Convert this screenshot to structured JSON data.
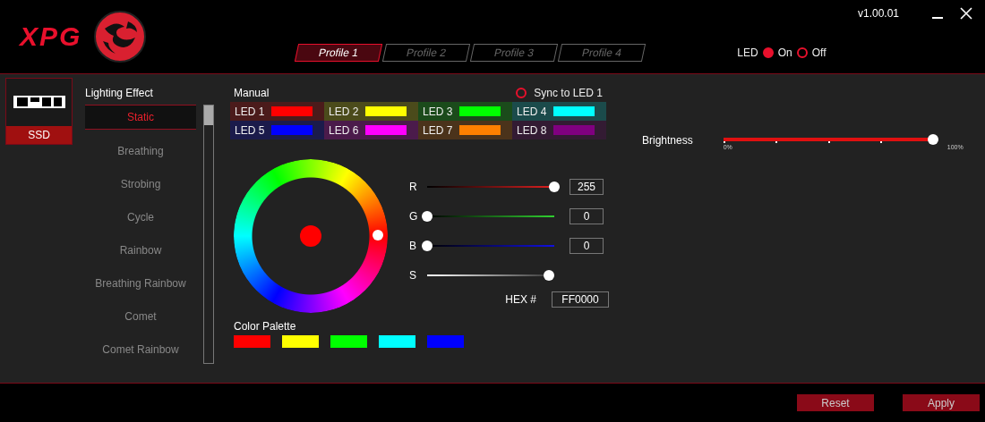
{
  "window": {
    "logo": "XPG",
    "version": "v1.00.01"
  },
  "profiles": [
    {
      "label": "Profile 1",
      "selected": true
    },
    {
      "label": "Profile 2",
      "selected": false
    },
    {
      "label": "Profile 3",
      "selected": false
    },
    {
      "label": "Profile 4",
      "selected": false
    }
  ],
  "led_power": {
    "label": "LED",
    "options": [
      {
        "label": "On",
        "selected": true
      },
      {
        "label": "Off",
        "selected": false
      }
    ]
  },
  "device": {
    "label": "SSD",
    "selected": true
  },
  "lighting_effect": {
    "title": "Lighting Effect",
    "items": [
      {
        "label": "Static",
        "selected": true
      },
      {
        "label": "Breathing",
        "selected": false
      },
      {
        "label": "Strobing",
        "selected": false
      },
      {
        "label": "Cycle",
        "selected": false
      },
      {
        "label": "Rainbow",
        "selected": false
      },
      {
        "label": "Breathing Rainbow",
        "selected": false
      },
      {
        "label": "Comet",
        "selected": false
      },
      {
        "label": "Comet Rainbow",
        "selected": false
      }
    ]
  },
  "manual": {
    "title": "Manual",
    "sync": {
      "label": "Sync to LED 1",
      "checked": false
    },
    "leds": [
      {
        "label": "LED 1",
        "color": "#ff0000"
      },
      {
        "label": "LED 2",
        "color": "#ffff00"
      },
      {
        "label": "LED 3",
        "color": "#00ff00"
      },
      {
        "label": "LED 4",
        "color": "#00ffff"
      },
      {
        "label": "LED 5",
        "color": "#0000ff"
      },
      {
        "label": "LED 6",
        "color": "#ff00ff"
      },
      {
        "label": "LED 7",
        "color": "#ff8000"
      },
      {
        "label": "LED 8",
        "color": "#800080"
      }
    ]
  },
  "sliders": [
    {
      "label": "R",
      "kind": "red",
      "level": 1,
      "value": "255"
    },
    {
      "label": "G",
      "kind": "green",
      "level": 0,
      "value": "0"
    },
    {
      "label": "B",
      "kind": "blue",
      "level": 0,
      "value": "0"
    },
    {
      "label": "S",
      "kind": "saturation",
      "level": 0.96
    }
  ],
  "hex": {
    "label": "HEX #",
    "value": "FF0000"
  },
  "palette": {
    "title": "Color Palette",
    "swatches": [
      {
        "color": "#ff0000"
      },
      {
        "color": "#ffff00"
      },
      {
        "color": "#00ff00"
      },
      {
        "color": "#00ffff"
      },
      {
        "color": "#0000ff"
      }
    ]
  },
  "brightness": {
    "label": "Brightness",
    "level": 1,
    "min_label": "0%",
    "max_label": "100%"
  },
  "buttons": [
    {
      "label": "Reset"
    },
    {
      "label": "Apply"
    }
  ]
}
